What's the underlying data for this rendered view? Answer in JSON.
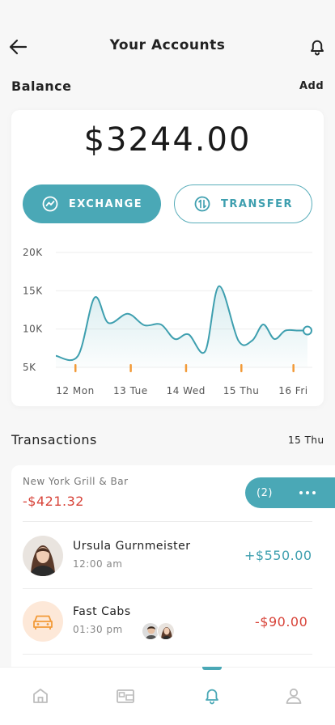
{
  "header": {
    "title": "Your Accounts",
    "back_icon": "arrow-left-icon",
    "bell_icon": "bell-icon"
  },
  "balance": {
    "label": "Balance",
    "add_label": "Add",
    "amount": "$3244.00",
    "exchange_label": "EXCHANGE",
    "transfer_label": "TRANSFER"
  },
  "chart_data": {
    "type": "line",
    "y_ticks": [
      "20K",
      "15K",
      "10K",
      "5K"
    ],
    "ylim": [
      5000,
      20000
    ],
    "x_labels": [
      "12 Mon",
      "13 Tue",
      "14 Wed",
      "15 Thu",
      "16 Fri"
    ],
    "series": [
      {
        "x": [
          12.0,
          12.4,
          12.7,
          12.95,
          13.3,
          13.6,
          13.9,
          14.15,
          14.4,
          14.7,
          14.95,
          15.3,
          15.55,
          15.75,
          15.95,
          16.15,
          16.38,
          16.55
        ],
        "values": [
          6500,
          6500,
          14100,
          10800,
          12000,
          10500,
          10600,
          8700,
          9300,
          7100,
          15600,
          8500,
          8500,
          10600,
          8700,
          9800,
          9800,
          9800
        ]
      }
    ],
    "color": "#3e9faf",
    "marker_color": "#f29a38"
  },
  "transactions": {
    "title": "Transactions",
    "date": "15 Thu",
    "items": [
      {
        "name": "New York Grill & Bar",
        "amount": "-$421.32",
        "badge": "(2)"
      },
      {
        "name": "Ursula Gurnmeister",
        "time": "12:00 am",
        "amount": "+$550.00"
      },
      {
        "name": "Fast Cabs",
        "time": "01:30 pm",
        "amount": "-$90.00"
      }
    ]
  },
  "colors": {
    "accent": "#4aa8b6",
    "negative": "#d8443a",
    "positive": "#3e9faf"
  },
  "nav": {
    "items": [
      "home-icon",
      "wallet-icon",
      "bell-icon",
      "user-icon"
    ],
    "active": 2
  }
}
